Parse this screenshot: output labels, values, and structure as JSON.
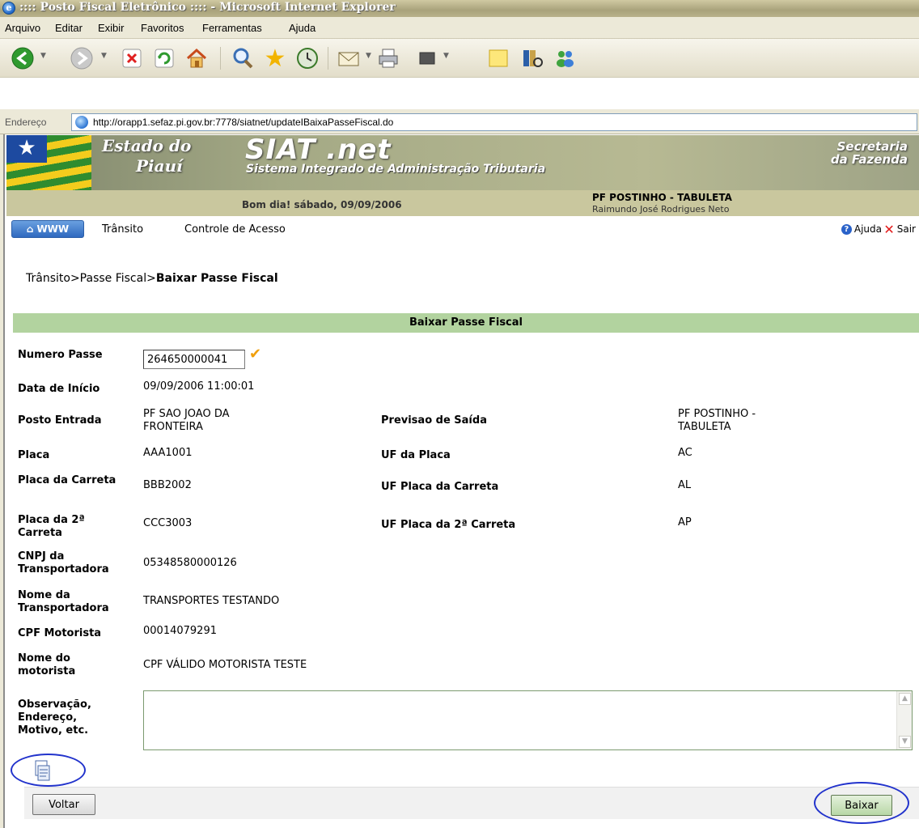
{
  "browser": {
    "title": ":::: Posto Fiscal Eletrônico :::: - Microsoft Internet Explorer",
    "menu": [
      "Arquivo",
      "Editar",
      "Exibir",
      "Favoritos",
      "Ferramentas",
      "Ajuda"
    ],
    "address_label": "Endereço",
    "url": "http://orapp1.sefaz.pi.gov.br:7778/siatnet/updateIBaixaPasseFiscal.do"
  },
  "header": {
    "estado_line1": "Estado do",
    "estado_line2": "Piauí",
    "app_name": "SIAT .net",
    "app_subtitle": "Sistema Integrado de Administração Tributaria",
    "secretaria_line1": "Secretaria",
    "secretaria_line2": "da Fazenda",
    "greeting": "Bom dia! sábado, 09/09/2006",
    "posto": "PF POSTINHO - TABULETA",
    "usuario": "Raimundo José Rodrigues Neto"
  },
  "appmenu": {
    "www_label": "WWW",
    "items": [
      "Trânsito",
      "Controle de Acesso"
    ],
    "ajuda": "Ajuda",
    "sair": "Sair"
  },
  "breadcrumb": {
    "part1": "Trânsito>Passe Fiscal>",
    "current": "Baixar Passe Fiscal"
  },
  "form": {
    "title": "Baixar Passe Fiscal",
    "numero_passe_label": "Numero Passe",
    "numero_passe_value": "264650000041",
    "data_inicio_label": "Data de Início",
    "data_inicio_value": "09/09/2006 11:00:01",
    "posto_entrada_label": "Posto Entrada",
    "posto_entrada_value": "PF SAO JOAO DA FRONTEIRA",
    "previsao_saida_label": "Previsao de Saída",
    "previsao_saida_value": "PF POSTINHO - TABULETA",
    "placa_label": "Placa",
    "placa_value": "AAA1001",
    "uf_placa_label": "UF da Placa",
    "uf_placa_value": "AC",
    "placa_carreta_label": "Placa da Carreta",
    "placa_carreta_value": "BBB2002",
    "uf_placa_carreta_label": "UF Placa da Carreta",
    "uf_placa_carreta_value": "AL",
    "placa_2_carreta_label": "Placa da 2ª Carreta",
    "placa_2_carreta_value": "CCC3003",
    "uf_placa_2_carreta_label": "UF Placa da 2ª Carreta",
    "uf_placa_2_carreta_value": "AP",
    "cnpj_label": "CNPJ da Transportadora",
    "cnpj_value": "05348580000126",
    "nome_transp_label": "Nome da Transportadora",
    "nome_transp_value": "TRANSPORTES TESTANDO",
    "cpf_label": "CPF Motorista",
    "cpf_value": "00014079291",
    "nome_motorista_label": "Nome do motorista",
    "nome_motorista_value": "CPF VÁLIDO MOTORISTA TESTE",
    "observacao_label": "Observação, Endereço, Motivo, etc.",
    "observacao_value": ""
  },
  "buttons": {
    "voltar": "Voltar",
    "baixar": "Baixar"
  },
  "colors": {
    "form_header_bg": "#b2d39f",
    "annotation_ring": "#2233cc"
  }
}
